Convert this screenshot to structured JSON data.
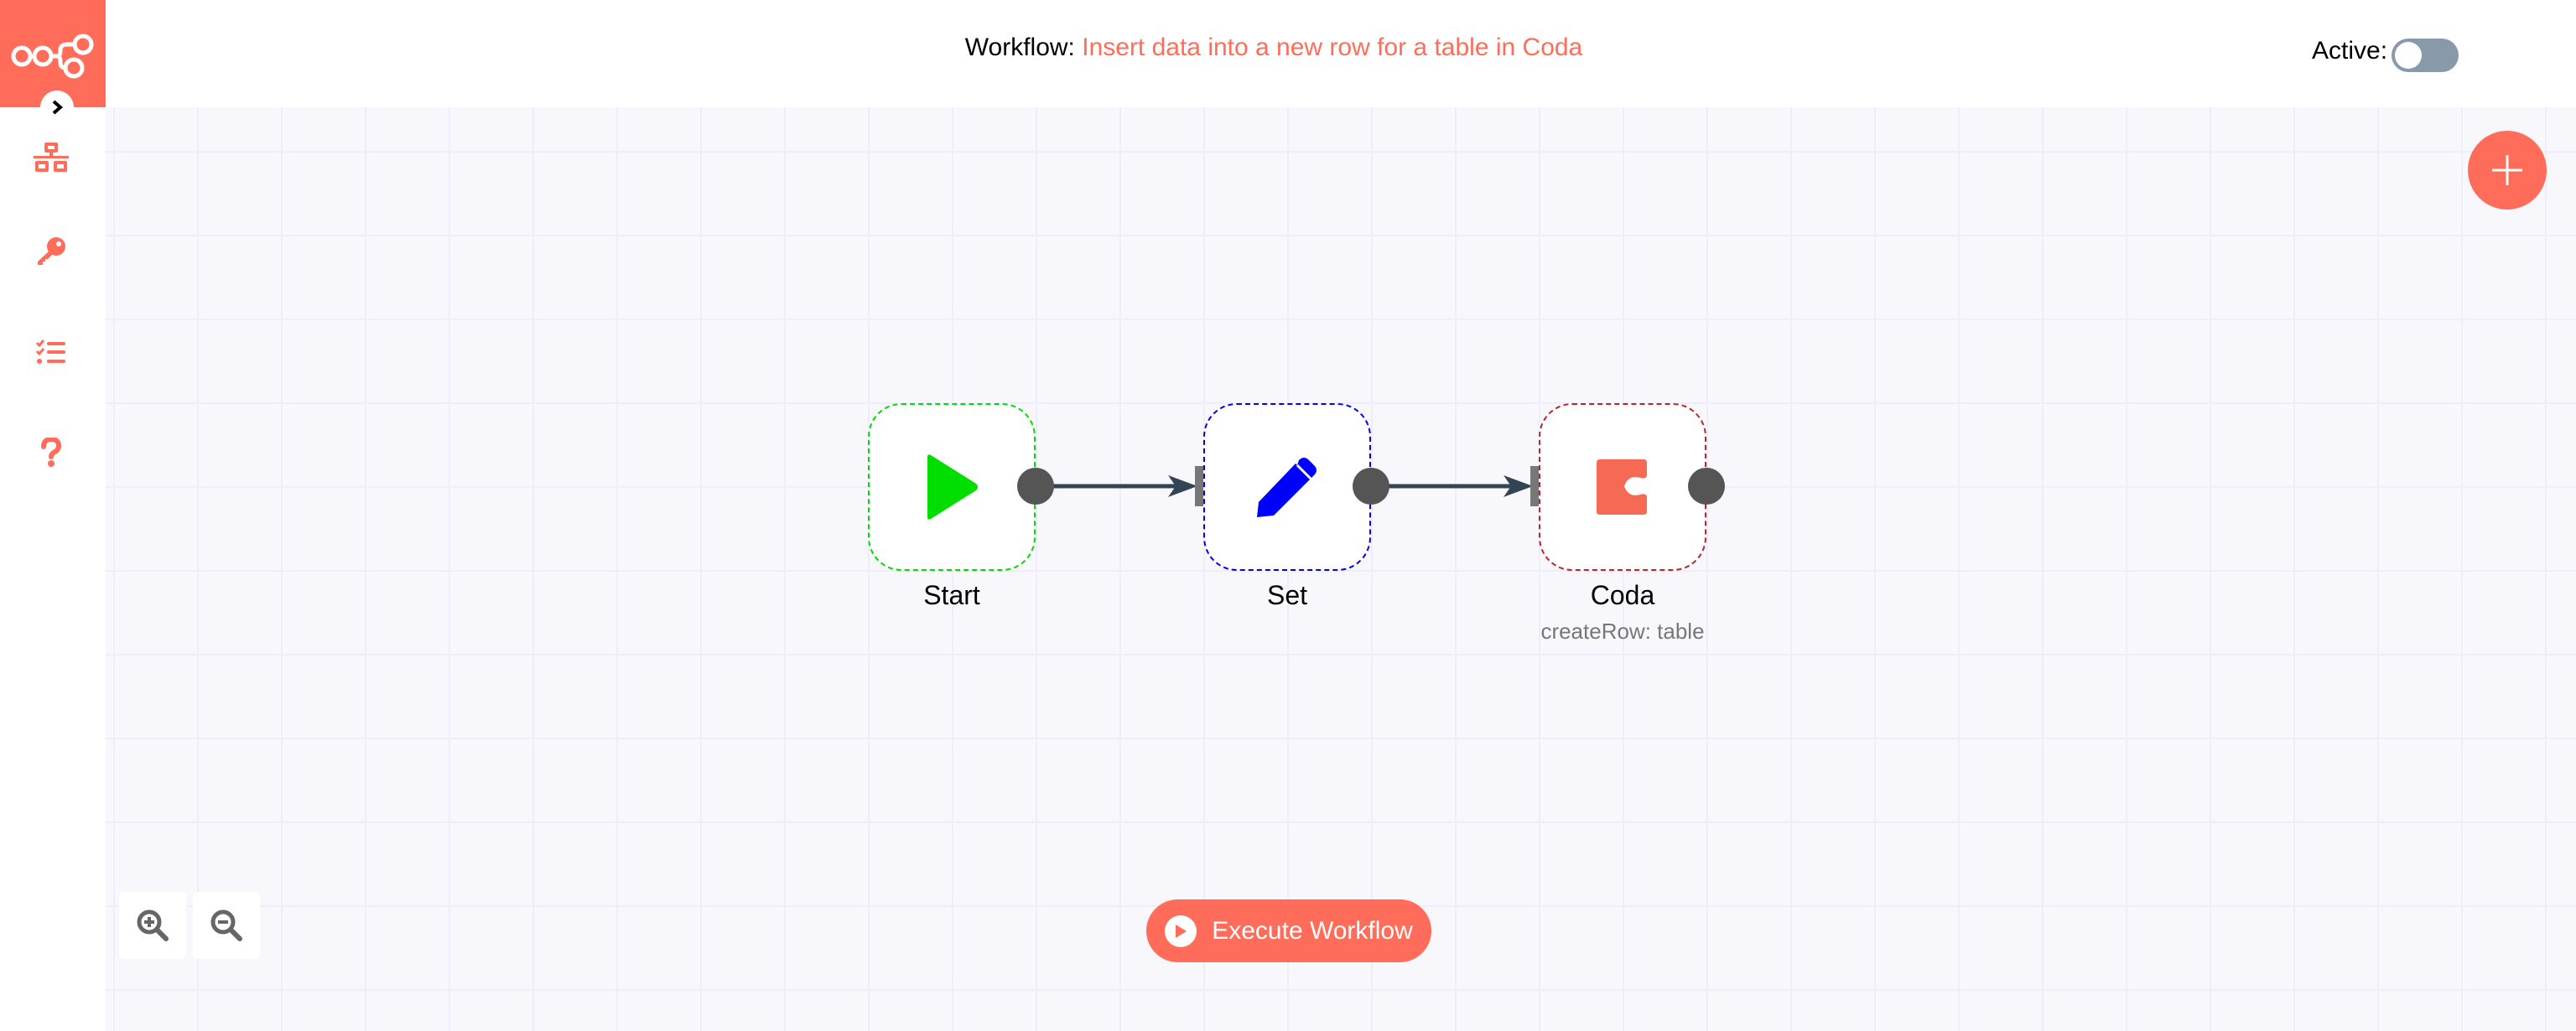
{
  "header": {
    "workflow_label": "Workflow:",
    "workflow_name": "Insert data into a new row for a table in Coda",
    "active_label": "Active:",
    "active": false
  },
  "sidebar": {
    "items": [
      {
        "icon": "network-icon",
        "label": "Workflows"
      },
      {
        "icon": "key-icon",
        "label": "Credentials"
      },
      {
        "icon": "checklist-icon",
        "label": "Executions"
      },
      {
        "icon": "question-icon",
        "label": "Help"
      }
    ]
  },
  "nodes": [
    {
      "name": "Start",
      "subtitle": "",
      "icon": "play-icon",
      "color": "#00dd00"
    },
    {
      "name": "Set",
      "subtitle": "",
      "icon": "pencil-icon",
      "color": "#0000ff"
    },
    {
      "name": "Coda",
      "subtitle": "createRow: table",
      "icon": "coda-icon",
      "color": "#c02228"
    }
  ],
  "connections": [
    {
      "from": "Start",
      "to": "Set"
    },
    {
      "from": "Set",
      "to": "Coda"
    }
  ],
  "controls": {
    "execute_label": "Execute Workflow",
    "zoom_in": "zoom-in",
    "zoom_out": "zoom-out"
  },
  "colors": {
    "brand": "#ff6d5a",
    "toggle_off": "#8899aa",
    "edge": "#334455"
  }
}
